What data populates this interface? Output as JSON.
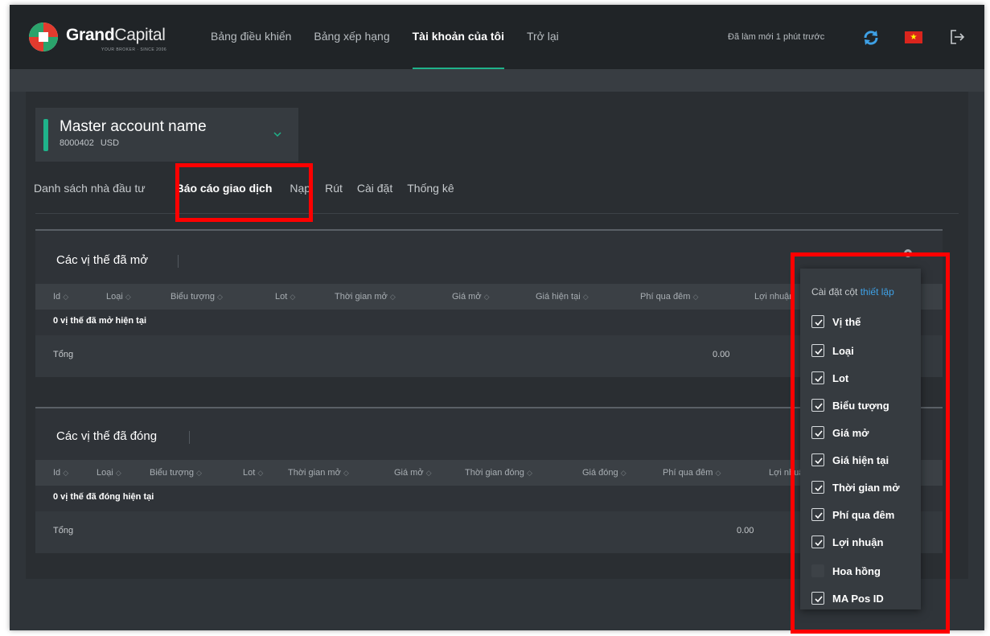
{
  "brand": {
    "name_bold": "Grand",
    "name_light": "Capital",
    "tagline": "YOUR BROKER · SINCE 2006"
  },
  "nav": {
    "items": [
      "Bảng điều khiển",
      "Bảng xếp hạng",
      "Tài khoản của tôi",
      "Trở lại"
    ],
    "active_index": 2,
    "refresh_text": "Đã làm mới 1 phút trước",
    "flag_glyph": "★"
  },
  "account": {
    "name": "Master account name",
    "number": "8000402",
    "currency": "USD"
  },
  "tabs": {
    "items": [
      "Danh sách nhà đầu tư",
      "Báo cáo giao dịch",
      "Nạp",
      "Rút",
      "Cài đặt",
      "Thống kê"
    ],
    "active_index": 1
  },
  "open_positions": {
    "title": "Các vị thế đã mở",
    "columns": [
      "Id",
      "Loại",
      "Biểu tượng",
      "Lot",
      "Thời gian mở",
      "Giá mở",
      "Giá hiện tại",
      "Phí qua đêm",
      "Lợi nhuận"
    ],
    "empty_text": "0 vị thế đã mở hiện tại",
    "total_label": "Tổng",
    "total_value": "0.00"
  },
  "closed_positions": {
    "title": "Các vị thế đã đóng",
    "columns": [
      "Id",
      "Loại",
      "Biểu tượng",
      "Lot",
      "Thời gian mở",
      "Giá mở",
      "Thời gian đóng",
      "Giá đóng",
      "Phí qua đêm",
      "Lợi nhuận"
    ],
    "empty_text": "0 vị thế đã đóng hiện tại",
    "total_label": "Tổng",
    "total_value": "0.00"
  },
  "column_settings": {
    "heading": "Cài đặt cột",
    "link": "thiết lập",
    "items": [
      {
        "label": "Vị thế",
        "checked": true
      },
      {
        "label": "Loại",
        "checked": true
      },
      {
        "label": "Lot",
        "checked": true
      },
      {
        "label": "Biểu tượng",
        "checked": true
      },
      {
        "label": "Giá mở",
        "checked": true
      },
      {
        "label": "Giá hiện tại",
        "checked": true
      },
      {
        "label": "Thời gian mở",
        "checked": true
      },
      {
        "label": "Phí qua đêm",
        "checked": true
      },
      {
        "label": "Lợi nhuận",
        "checked": true
      },
      {
        "label": "Hoa hồng",
        "checked": false
      },
      {
        "label": "MA Pos ID",
        "checked": true
      }
    ]
  },
  "colors": {
    "accent": "#1fb38a",
    "link": "#3ea1e6",
    "highlight": "#ff0000"
  }
}
